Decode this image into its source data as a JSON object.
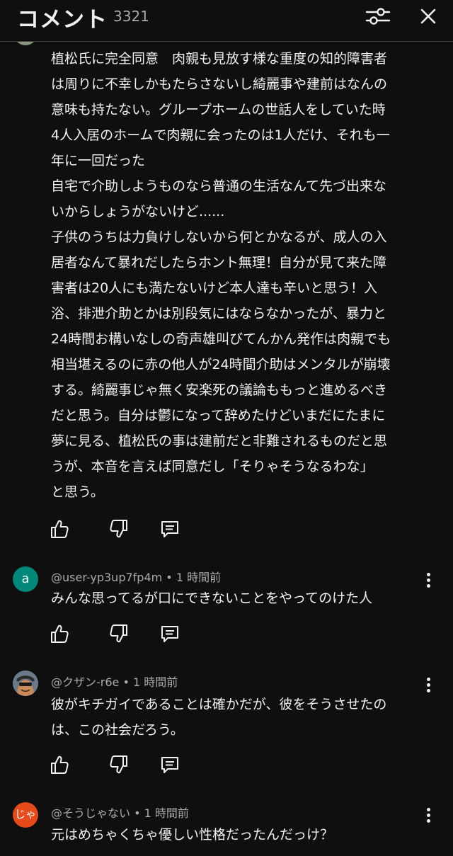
{
  "header": {
    "title": "コメント",
    "count": "3321"
  },
  "comments": [
    {
      "lines": [
        "植松氏に完全同意　肉親も見放す様な重度の知的障害者",
        "は周りに不幸しかもたらさないし綺麗事や建前はなんの",
        "意味も持たない。グループホームの世話人をしていた時",
        "4人入居のホームで肉親に会ったのは1人だけ、それも一",
        "年に一回だった",
        "自宅で介助しようものなら普通の生活なんて先づ出来な",
        "いからしょうがないけど......",
        "子供のうちは力負けしないから何とかなるが、成人の入",
        "居者なんて暴れだしたらホント無理！自分が見て来た障",
        "害者は20人にも満たないけど本人達も辛いと思う！入",
        "浴、排泄介助とかは別段気にはならなかったが、暴力と",
        "24時間お構いなしの奇声雄叫びてんかん発作は肉親でも",
        "相当堪えるのに赤の他人が24時間介助はメンタルが崩壊",
        "する。綺麗事じゃ無く安楽死の議論ももっと進めるべき",
        "だと思う。自分は鬱になって辞めたけどいまだにたまに",
        "夢に見る、植松氏の事は建前だと非難されるものだと思",
        "うが、本音を言えば同意だし「そりゃそうなるわな」",
        "と思う。"
      ]
    },
    {
      "avatar_letter": "a",
      "avatar_color": "#00897b",
      "author": "@user-yp3up7fp4m",
      "time": "1 時間前",
      "lines": [
        "みんな思ってるが口にできないことをやってのけた人"
      ]
    },
    {
      "avatar_icon": "character-face-avatar",
      "author": "@クザン-r6e",
      "time": "1 時間前",
      "lines": [
        "彼がキチガイであることは確かだが、彼をそうさせたの",
        "は、この社会だろう。"
      ]
    },
    {
      "avatar_letter": "じゃ",
      "avatar_color": "#e64a19",
      "author": "@そうじゃない",
      "time": "1 時間前",
      "lines": [
        "元はめちゃくちゃ優しい性格だったんだっけ？"
      ]
    }
  ],
  "separator": " • "
}
